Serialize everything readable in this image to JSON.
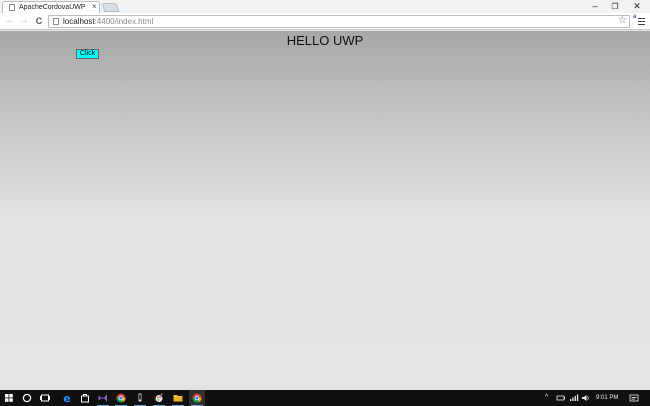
{
  "browser": {
    "tab": {
      "title": "ApacheCordovaUWP",
      "close_glyph": "×"
    },
    "window_controls": {
      "minimize": "–",
      "restore": "❐",
      "close": "✕"
    },
    "nav": {
      "back_glyph": "←",
      "forward_glyph": "→",
      "reload_glyph": "C"
    },
    "address": {
      "host": "localhost",
      "rest": ":4400/index.html"
    },
    "icons": [
      "page-icon",
      "star-icon",
      "extension-icon",
      "menu-icon"
    ],
    "ext_glyph": "a",
    "star_glyph": "☆"
  },
  "page": {
    "heading": "HELLO UWP",
    "button_label": "Click",
    "button_color": "#00ffff"
  },
  "taskbar": {
    "apps": [
      "windows-start",
      "cortana-search",
      "task-view",
      "edge",
      "store",
      "visual-studio",
      "chrome",
      "phone-app",
      "paint-app",
      "file-explorer",
      "chrome-active"
    ],
    "tray_chevron": "^",
    "clock": "9:01 PM"
  }
}
